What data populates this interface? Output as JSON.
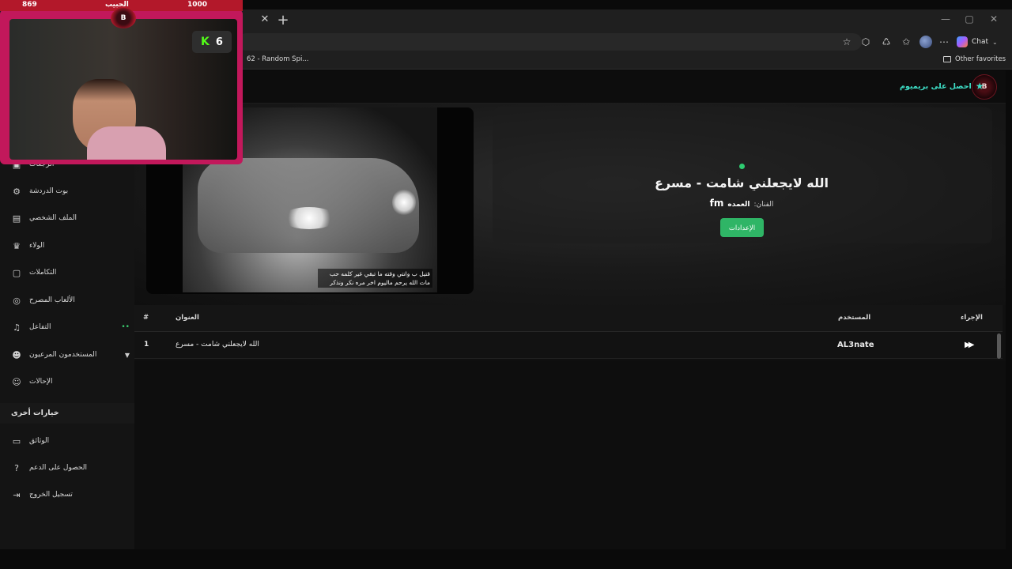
{
  "browser": {
    "tab_close": "✕",
    "tab_new": "+",
    "window": {
      "minimize": "—",
      "restore": "▢",
      "close": "✕"
    },
    "copilot_label": "Chat",
    "bookmark_item": "62 - Random Spi...",
    "other_favorites": "Other favorites"
  },
  "header": {
    "premium_label": "احصل على بريميوم",
    "logo_text": "B"
  },
  "sidebar": {
    "items": [
      {
        "label": "الرجعات",
        "icon": "gift-icon"
      },
      {
        "label": "بوت الدردشة",
        "icon": "robot-icon"
      },
      {
        "label": "الملف الشخصي",
        "icon": "id-card-icon"
      },
      {
        "label": "الولاء",
        "icon": "trophy-icon"
      },
      {
        "label": "التكاملات",
        "icon": "puzzle-icon"
      },
      {
        "label": "الألعاب المصرح",
        "icon": "gamepad-icon"
      },
      {
        "label": "التفاعل",
        "icon": "music-icon",
        "badge": "••"
      },
      {
        "label": "المستخدمون المرعيون",
        "icon": "users-icon"
      },
      {
        "label": "الإحالات",
        "icon": "user-group-icon"
      }
    ],
    "section_title": "خيارات أخرى",
    "other": [
      {
        "label": "الوثائق",
        "icon": "document-icon"
      },
      {
        "label": "الحصول على الدعم",
        "icon": "help-icon"
      },
      {
        "label": "تسجيل الخروج",
        "icon": "logout-icon"
      }
    ]
  },
  "hero": {
    "caption_line1": "قتيل ب وانتي وقته ما تبقي غير كلمه حب",
    "caption_line2": "مات الله يرحم ماليوم اخر مره نكر ونذكر",
    "song_title": "الله لايجعلني شامت - مسرع",
    "artist_label": "الفنان:",
    "artist_value": "العمده",
    "artist_fm": "fm",
    "settings_button": "الإعدادات"
  },
  "table": {
    "columns": {
      "num": "#",
      "title": "العنوان",
      "user": "المستخدم",
      "action": "الإجراء"
    },
    "rows": [
      {
        "num": "1",
        "title": "الله لايجعلني شامت - مسرع",
        "user": "AL3nate"
      }
    ]
  },
  "stream_overlay": {
    "left_stat": "869",
    "center_label": "الحبيب",
    "right_stat": "1000",
    "kick_letter": "K",
    "kick_count": "6",
    "badge_text": "B"
  },
  "colors": {
    "accent_green": "#2fb566",
    "premium_teal": "#3ee0c8",
    "overlay_red": "#b3182a",
    "kick_green": "#53fc18"
  }
}
